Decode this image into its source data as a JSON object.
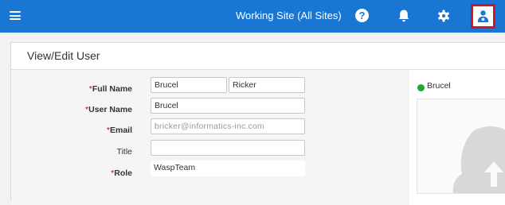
{
  "topbar": {
    "site_title": "Working Site (All Sites)",
    "help_label": "?",
    "colors": {
      "bar": "#1976d2",
      "highlight": "#d0142c"
    }
  },
  "panel": {
    "title": "View/Edit User"
  },
  "form": {
    "full_name": {
      "label": "Full Name",
      "first": "Brucel",
      "last": "Ricker"
    },
    "user_name": {
      "label": "User Name",
      "value": "Brucel"
    },
    "email": {
      "label": "Email",
      "value": "bricker@informatics-inc.com"
    },
    "title": {
      "label": "Title",
      "value": ""
    },
    "role": {
      "label": "Role",
      "value": "WaspTeam"
    }
  },
  "status": {
    "name": "Brucel",
    "color": "#22a33a"
  }
}
